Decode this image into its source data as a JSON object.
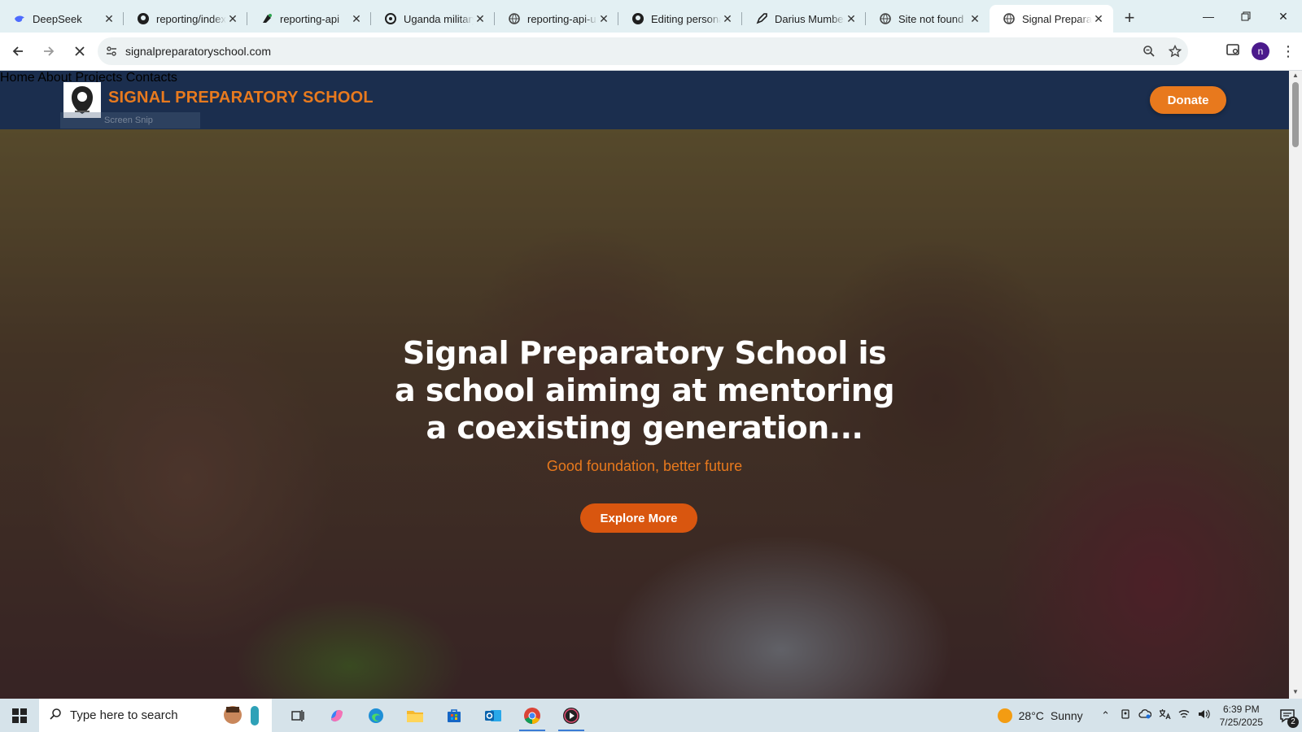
{
  "browser": {
    "tabs": [
      {
        "title": "DeepSeek",
        "icon": "deepseek-icon"
      },
      {
        "title": "reporting/index",
        "icon": "github-icon"
      },
      {
        "title": "reporting-api",
        "icon": "render-icon"
      },
      {
        "title": "Uganda military",
        "icon": "openai-icon"
      },
      {
        "title": "reporting-api-u",
        "icon": "globe-icon"
      },
      {
        "title": "Editing personal",
        "icon": "github-icon"
      },
      {
        "title": "Darius Mumbere",
        "icon": "rocket-icon"
      },
      {
        "title": "Site not found",
        "icon": "globe-icon"
      },
      {
        "title": "Signal Preparatory",
        "icon": "globe-icon",
        "active": true
      }
    ],
    "url": "signalpreparatoryschool.com",
    "profile_initial": "n"
  },
  "site": {
    "brand": "SIGNAL PREPARATORY SCHOOL",
    "snip_overlay": "Screen Snip",
    "nav": [
      "Home",
      "About",
      "Projects",
      "Contacts"
    ],
    "donate": "Donate",
    "hero": {
      "headline": "Signal Preparatory School is a school aiming at mentoring a coexisting generation...",
      "tagline": "Good foundation, better future",
      "cta": "Explore More"
    },
    "colors": {
      "nav_bg": "#1b2e4e",
      "accent": "#e8791d",
      "cta": "#d9560f"
    }
  },
  "taskbar": {
    "search_placeholder": "Type here to search",
    "weather_temp": "28°C",
    "weather_text": "Sunny",
    "time": "6:39 PM",
    "date": "7/25/2025",
    "notification_count": "2"
  }
}
